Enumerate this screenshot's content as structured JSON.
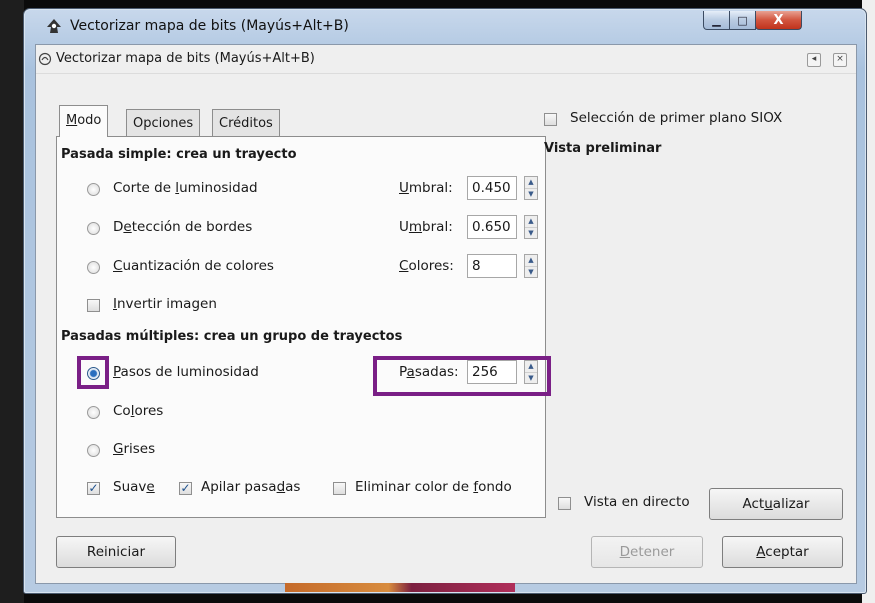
{
  "window": {
    "title": "Vectorizar mapa de bits (Mayús+Alt+B)",
    "caption_min": "▁",
    "caption_max": "□",
    "caption_close": "X"
  },
  "dock": {
    "title": "Vectorizar mapa de bits (Mayús+Alt+B)",
    "back_glyph": "◂",
    "close_glyph": "×"
  },
  "tabs": [
    {
      "label_u": "M",
      "label_rest": "odo"
    },
    {
      "label": "Opciones"
    },
    {
      "label": "Créditos"
    }
  ],
  "single_scan": {
    "heading": "Pasada simple: crea un trayecto",
    "rows": [
      {
        "pre": "Corte de ",
        "u": "l",
        "post": "uminosidad",
        "param_u": "U",
        "param_rest": "mbral:",
        "value": "0.450"
      },
      {
        "pre": "D",
        "u": "e",
        "post": "tección de bordes",
        "param_pre": "U",
        "param_u": "m",
        "param_rest": "bral:",
        "value": "0.650"
      },
      {
        "pre": "",
        "u": "C",
        "post": "uantización de colores",
        "param_u": "C",
        "param_rest": "olores:",
        "value": "8"
      }
    ],
    "invert": {
      "u": "I",
      "rest": "nvertir imagen"
    }
  },
  "multi_scan": {
    "heading": "Pasadas múltiples: crea un grupo de trayectos",
    "rows": [
      {
        "u": "P",
        "rest": "asos de luminosidad",
        "selected": true
      },
      {
        "pre": "Co",
        "u": "l",
        "rest": "ores",
        "selected": false
      },
      {
        "u": "G",
        "rest": "rises",
        "selected": false
      }
    ],
    "passes": {
      "pre": "P",
      "u": "a",
      "rest": "sadas:",
      "value": "256"
    },
    "smooth": {
      "pre": "Suav",
      "u": "e",
      "checked": true
    },
    "stack": {
      "pre": "Apilar pasa",
      "u": "d",
      "rest": "as",
      "checked": true
    },
    "remove_bg": {
      "pre": "Eliminar color de ",
      "u": "f",
      "rest": "ondo",
      "checked": false
    }
  },
  "right_panel": {
    "siox": "Selección de primer plano SIOX",
    "preview_heading": "Vista preliminar",
    "live": "Vista en directo",
    "update": {
      "pre": "Act",
      "u": "u",
      "rest": "alizar"
    }
  },
  "buttons": {
    "reset": "Reiniciar",
    "stop": {
      "u": "D",
      "rest": "etener"
    },
    "ok": {
      "u": "A",
      "rest": "ceptar"
    }
  },
  "colors": {
    "highlight": "#7a1f86"
  }
}
